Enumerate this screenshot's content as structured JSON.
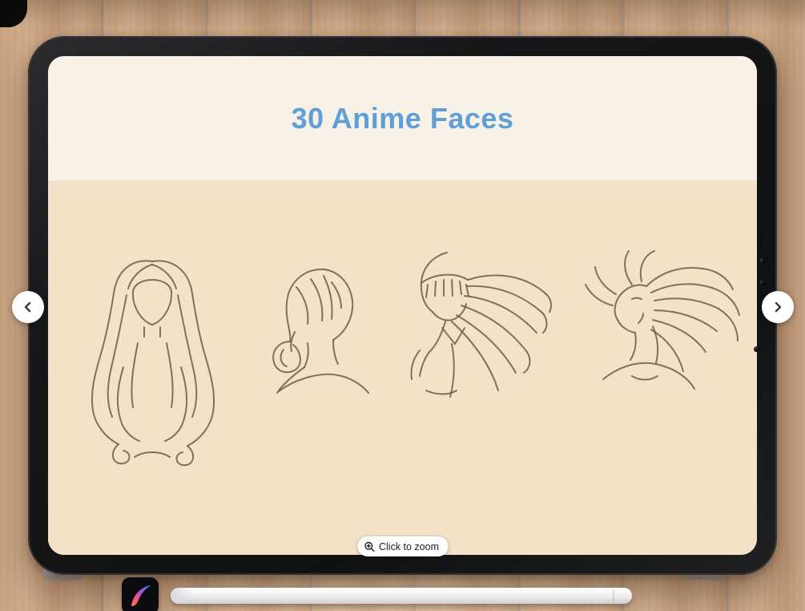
{
  "viewer": {
    "title": "30 Anime Faces",
    "zoom_button": {
      "label": "Click to zoom",
      "icon": "magnifier-plus-icon"
    },
    "nav": {
      "prev_icon": "chevron-left-icon",
      "next_icon": "chevron-right-icon"
    },
    "colors": {
      "title_blue": "#5E9FD8",
      "header_cream": "#F7F1E6",
      "canvas_beige": "#F3E2C8",
      "tablet_frame": "#17171A",
      "pill_white": "#FFFFFF"
    },
    "illustrations": [
      {
        "label": "long wavy hair, front view sketch"
      },
      {
        "label": "braided updo, back side view sketch"
      },
      {
        "label": "long straight hair with bangs, flowing sketch"
      },
      {
        "label": "messy windblown hair, looking up sketch"
      }
    ],
    "props": {
      "device": "tablet",
      "stylus": "apple-pencil",
      "app_logo": "procreate-logo"
    }
  }
}
